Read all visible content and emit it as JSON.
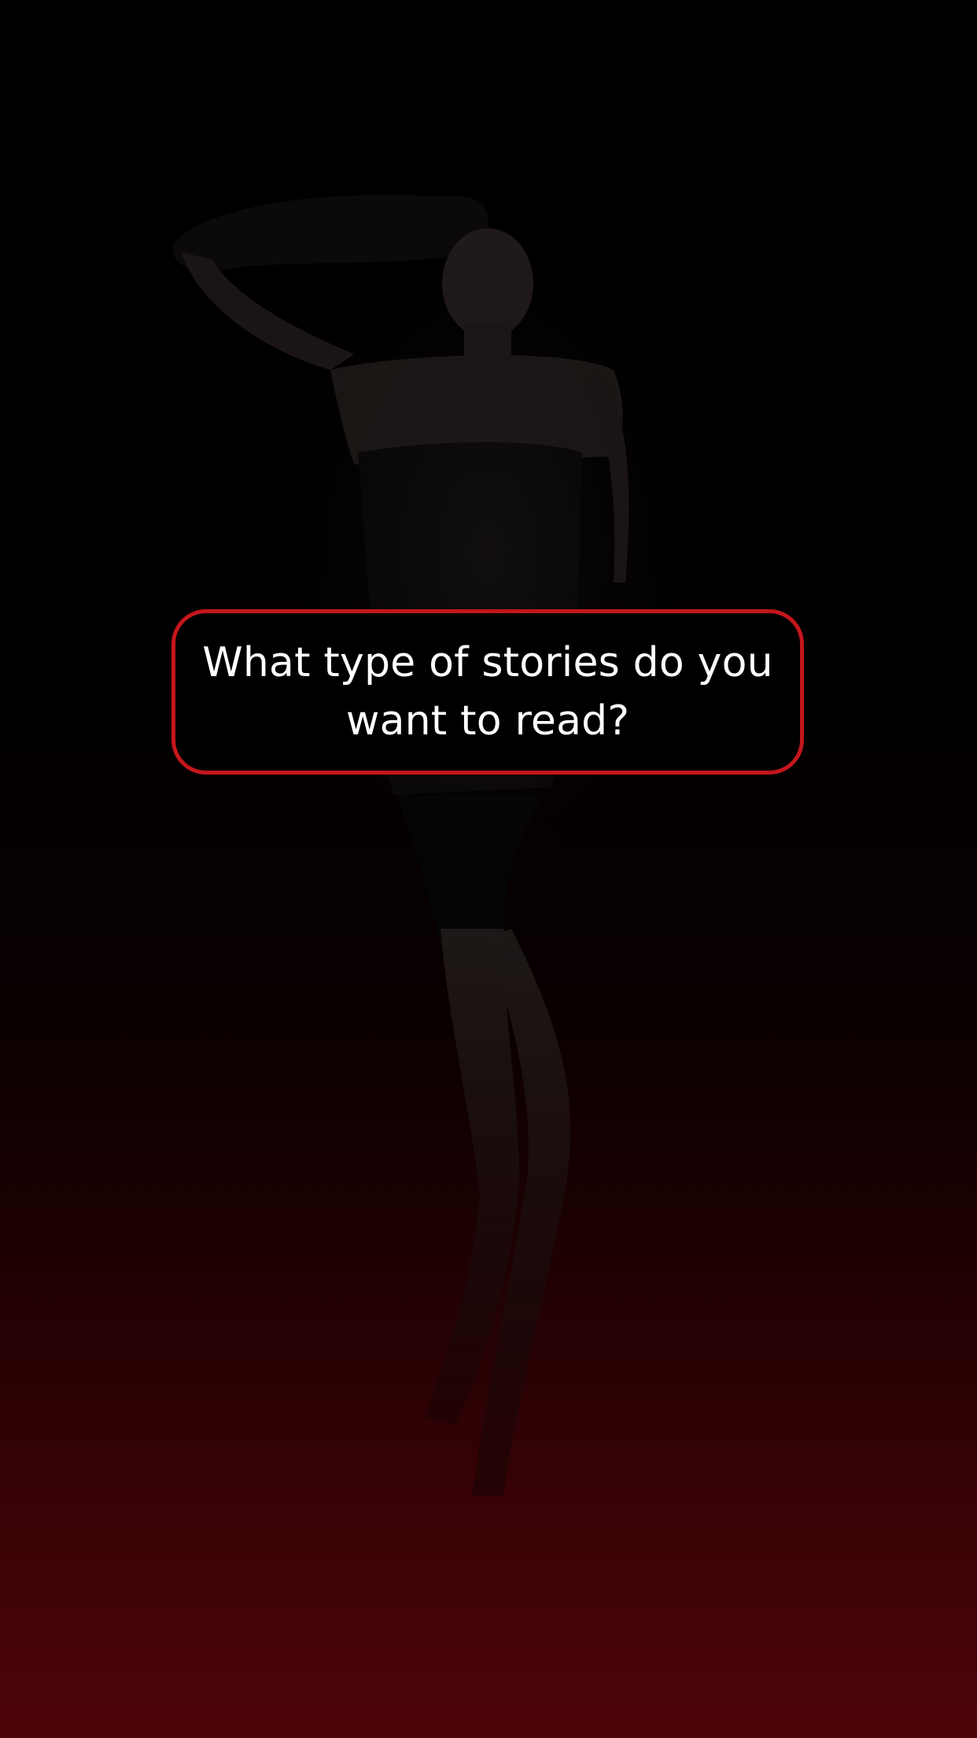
{
  "onboarding": {
    "question": "What type of stories do you want to read?"
  },
  "colors": {
    "card_border": "#c4161c",
    "card_background": "#000000",
    "text": "#ffffff",
    "gradient_top": "#000000",
    "gradient_bottom": "#4e0508"
  },
  "background": {
    "image_subject": "woman-in-lingerie-silhouette"
  }
}
